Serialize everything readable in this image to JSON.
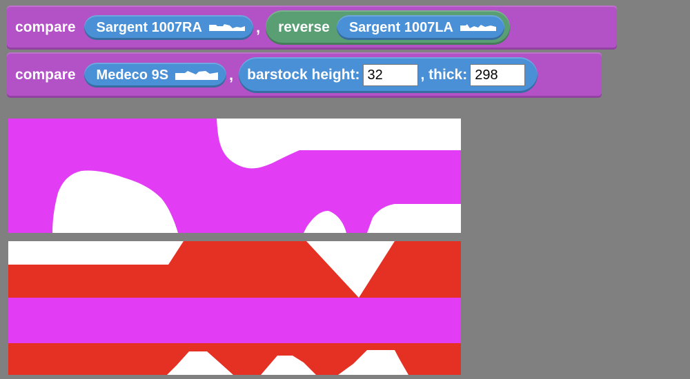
{
  "block1": {
    "compare_label": "compare",
    "first_key": "Sargent 1007RA",
    "comma": ",",
    "reverse_label": "reverse",
    "second_key": "Sargent 1007LA"
  },
  "block2": {
    "compare_label": "compare",
    "key": "Medeco 9S",
    "comma": ",",
    "barstock_height_label": "barstock height:",
    "barstock_height_value": "32",
    "thick_label": ", thick:",
    "thick_value": "298"
  },
  "colors": {
    "background": "#808080",
    "compare_block": "#b352c6",
    "reporter": "#4a90d6",
    "reverse_block": "#5a9e73",
    "key_magenta": "#e23cf4",
    "key_red": "#e53124",
    "canvas_white": "#ffffff"
  }
}
